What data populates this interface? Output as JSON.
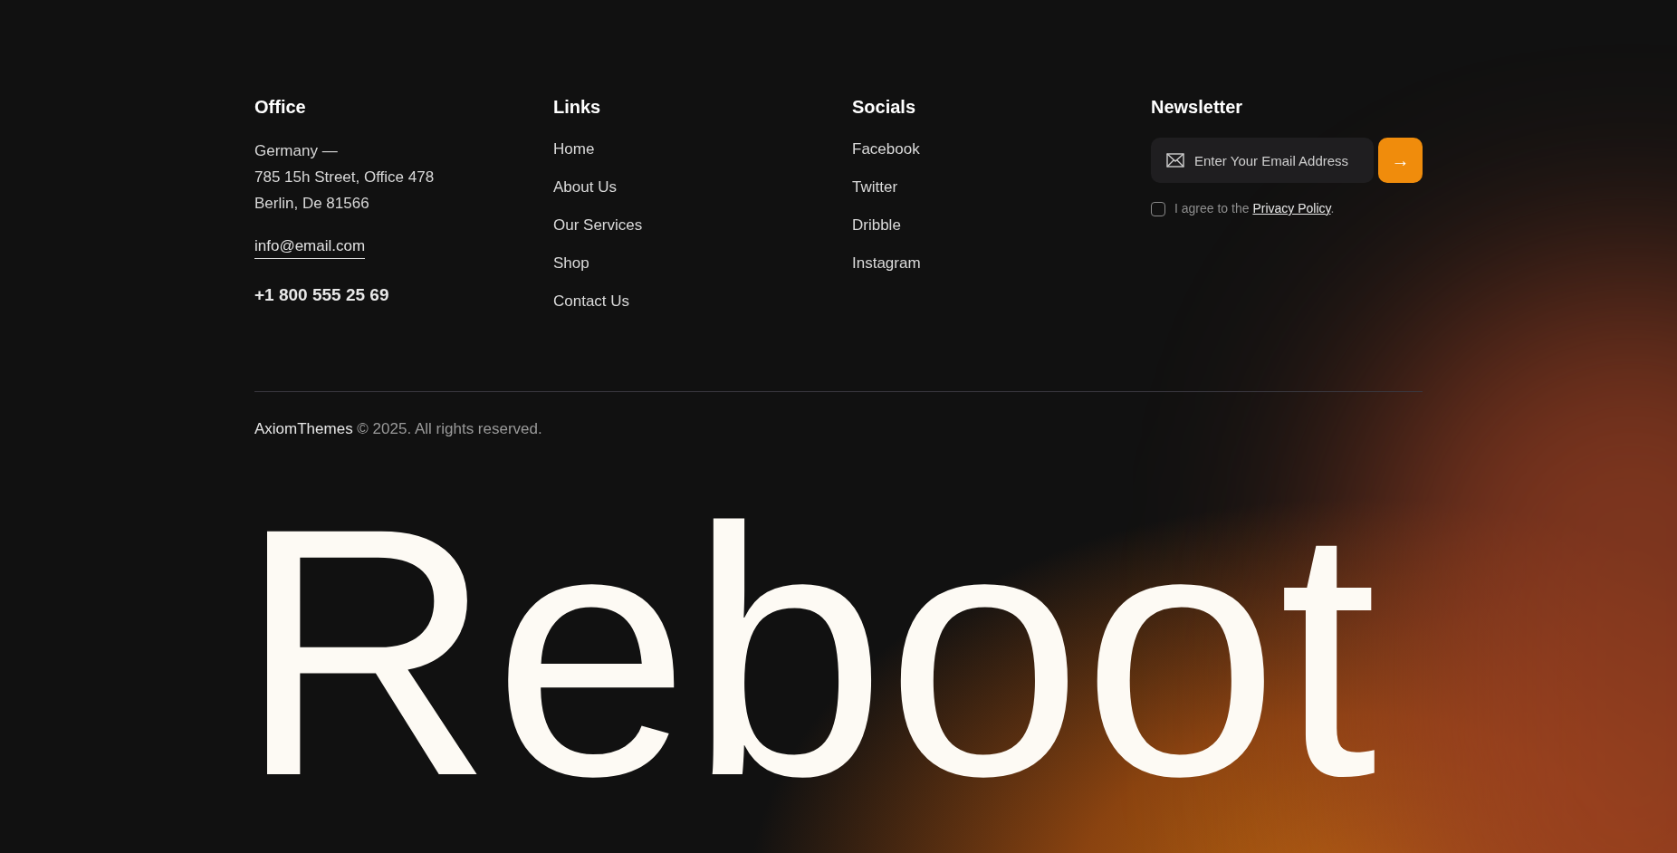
{
  "office": {
    "heading": "Office",
    "address": [
      "Germany —",
      "785 15h Street, Office 478",
      "Berlin, De 81566"
    ],
    "email": "info@email.com",
    "phone": "+1 800 555 25 69"
  },
  "links": {
    "heading": "Links",
    "items": [
      "Home",
      "About Us",
      "Our Services",
      "Shop",
      "Contact Us"
    ]
  },
  "socials": {
    "heading": "Socials",
    "items": [
      "Facebook",
      "Twitter",
      "Dribble",
      "Instagram"
    ]
  },
  "newsletter": {
    "heading": "Newsletter",
    "placeholder": "Enter Your Email Address",
    "submit": "→",
    "consent": {
      "checked": false,
      "text": "I agree to the",
      "link": "Privacy Policy",
      "suffix": "."
    }
  },
  "copyright": {
    "brand": "AxiomThemes",
    "text": "© 2025. All rights reserved."
  },
  "wordmark": "Reboot"
}
